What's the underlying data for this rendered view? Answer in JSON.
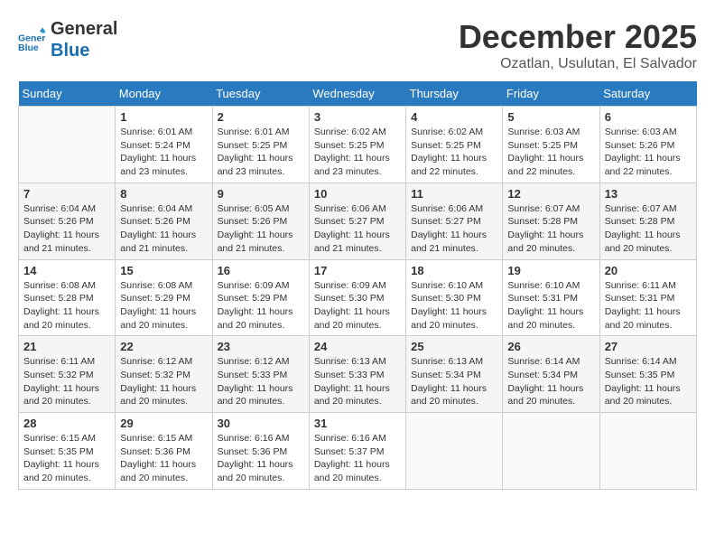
{
  "header": {
    "logo_line1": "General",
    "logo_line2": "Blue",
    "month": "December 2025",
    "location": "Ozatlan, Usulutan, El Salvador"
  },
  "days_of_week": [
    "Sunday",
    "Monday",
    "Tuesday",
    "Wednesday",
    "Thursday",
    "Friday",
    "Saturday"
  ],
  "weeks": [
    [
      {
        "day": "",
        "info": ""
      },
      {
        "day": "1",
        "info": "Sunrise: 6:01 AM\nSunset: 5:24 PM\nDaylight: 11 hours\nand 23 minutes."
      },
      {
        "day": "2",
        "info": "Sunrise: 6:01 AM\nSunset: 5:25 PM\nDaylight: 11 hours\nand 23 minutes."
      },
      {
        "day": "3",
        "info": "Sunrise: 6:02 AM\nSunset: 5:25 PM\nDaylight: 11 hours\nand 23 minutes."
      },
      {
        "day": "4",
        "info": "Sunrise: 6:02 AM\nSunset: 5:25 PM\nDaylight: 11 hours\nand 22 minutes."
      },
      {
        "day": "5",
        "info": "Sunrise: 6:03 AM\nSunset: 5:25 PM\nDaylight: 11 hours\nand 22 minutes."
      },
      {
        "day": "6",
        "info": "Sunrise: 6:03 AM\nSunset: 5:26 PM\nDaylight: 11 hours\nand 22 minutes."
      }
    ],
    [
      {
        "day": "7",
        "info": "Sunrise: 6:04 AM\nSunset: 5:26 PM\nDaylight: 11 hours\nand 21 minutes."
      },
      {
        "day": "8",
        "info": "Sunrise: 6:04 AM\nSunset: 5:26 PM\nDaylight: 11 hours\nand 21 minutes."
      },
      {
        "day": "9",
        "info": "Sunrise: 6:05 AM\nSunset: 5:26 PM\nDaylight: 11 hours\nand 21 minutes."
      },
      {
        "day": "10",
        "info": "Sunrise: 6:06 AM\nSunset: 5:27 PM\nDaylight: 11 hours\nand 21 minutes."
      },
      {
        "day": "11",
        "info": "Sunrise: 6:06 AM\nSunset: 5:27 PM\nDaylight: 11 hours\nand 21 minutes."
      },
      {
        "day": "12",
        "info": "Sunrise: 6:07 AM\nSunset: 5:28 PM\nDaylight: 11 hours\nand 20 minutes."
      },
      {
        "day": "13",
        "info": "Sunrise: 6:07 AM\nSunset: 5:28 PM\nDaylight: 11 hours\nand 20 minutes."
      }
    ],
    [
      {
        "day": "14",
        "info": "Sunrise: 6:08 AM\nSunset: 5:28 PM\nDaylight: 11 hours\nand 20 minutes."
      },
      {
        "day": "15",
        "info": "Sunrise: 6:08 AM\nSunset: 5:29 PM\nDaylight: 11 hours\nand 20 minutes."
      },
      {
        "day": "16",
        "info": "Sunrise: 6:09 AM\nSunset: 5:29 PM\nDaylight: 11 hours\nand 20 minutes."
      },
      {
        "day": "17",
        "info": "Sunrise: 6:09 AM\nSunset: 5:30 PM\nDaylight: 11 hours\nand 20 minutes."
      },
      {
        "day": "18",
        "info": "Sunrise: 6:10 AM\nSunset: 5:30 PM\nDaylight: 11 hours\nand 20 minutes."
      },
      {
        "day": "19",
        "info": "Sunrise: 6:10 AM\nSunset: 5:31 PM\nDaylight: 11 hours\nand 20 minutes."
      },
      {
        "day": "20",
        "info": "Sunrise: 6:11 AM\nSunset: 5:31 PM\nDaylight: 11 hours\nand 20 minutes."
      }
    ],
    [
      {
        "day": "21",
        "info": "Sunrise: 6:11 AM\nSunset: 5:32 PM\nDaylight: 11 hours\nand 20 minutes."
      },
      {
        "day": "22",
        "info": "Sunrise: 6:12 AM\nSunset: 5:32 PM\nDaylight: 11 hours\nand 20 minutes."
      },
      {
        "day": "23",
        "info": "Sunrise: 6:12 AM\nSunset: 5:33 PM\nDaylight: 11 hours\nand 20 minutes."
      },
      {
        "day": "24",
        "info": "Sunrise: 6:13 AM\nSunset: 5:33 PM\nDaylight: 11 hours\nand 20 minutes."
      },
      {
        "day": "25",
        "info": "Sunrise: 6:13 AM\nSunset: 5:34 PM\nDaylight: 11 hours\nand 20 minutes."
      },
      {
        "day": "26",
        "info": "Sunrise: 6:14 AM\nSunset: 5:34 PM\nDaylight: 11 hours\nand 20 minutes."
      },
      {
        "day": "27",
        "info": "Sunrise: 6:14 AM\nSunset: 5:35 PM\nDaylight: 11 hours\nand 20 minutes."
      }
    ],
    [
      {
        "day": "28",
        "info": "Sunrise: 6:15 AM\nSunset: 5:35 PM\nDaylight: 11 hours\nand 20 minutes."
      },
      {
        "day": "29",
        "info": "Sunrise: 6:15 AM\nSunset: 5:36 PM\nDaylight: 11 hours\nand 20 minutes."
      },
      {
        "day": "30",
        "info": "Sunrise: 6:16 AM\nSunset: 5:36 PM\nDaylight: 11 hours\nand 20 minutes."
      },
      {
        "day": "31",
        "info": "Sunrise: 6:16 AM\nSunset: 5:37 PM\nDaylight: 11 hours\nand 20 minutes."
      },
      {
        "day": "",
        "info": ""
      },
      {
        "day": "",
        "info": ""
      },
      {
        "day": "",
        "info": ""
      }
    ]
  ]
}
